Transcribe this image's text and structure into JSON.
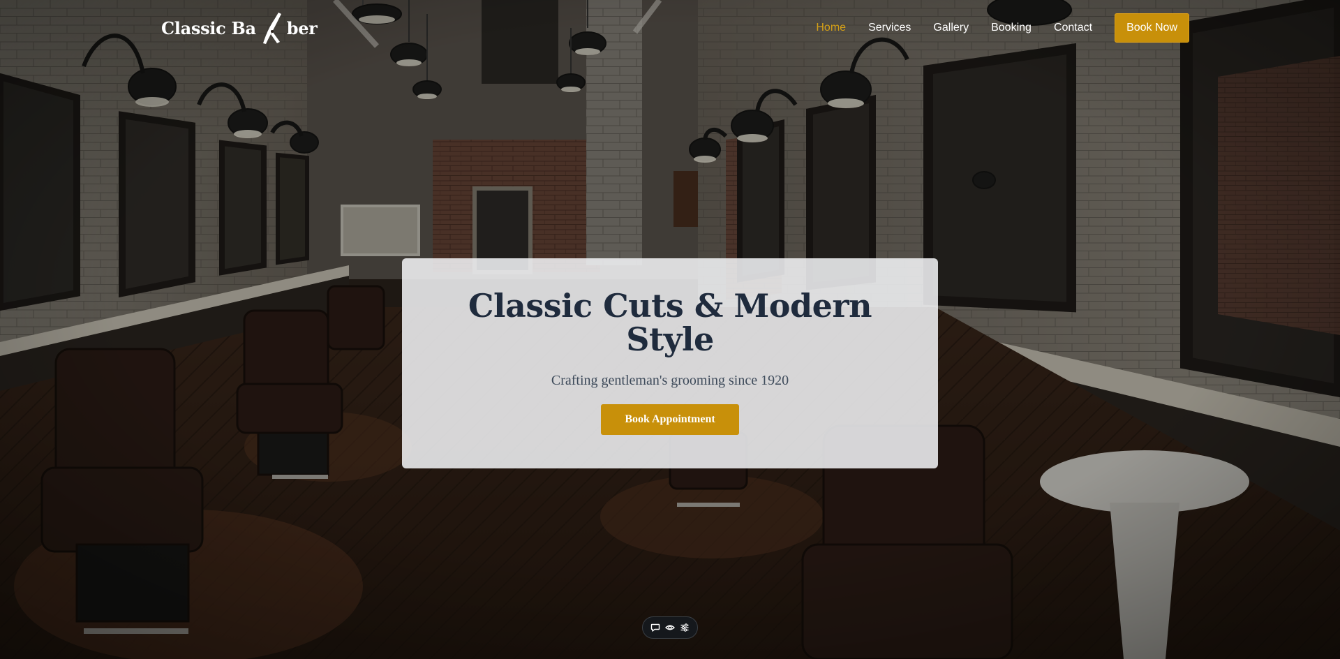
{
  "header": {
    "logo": {
      "part1": "Classic Ba",
      "part2": "ber",
      "icon": "razor-icon"
    },
    "nav": [
      {
        "label": "Home",
        "active": true
      },
      {
        "label": "Services",
        "active": false
      },
      {
        "label": "Gallery",
        "active": false
      },
      {
        "label": "Booking",
        "active": false
      },
      {
        "label": "Contact",
        "active": false
      }
    ],
    "book_now_label": "Book Now"
  },
  "hero": {
    "title": "Classic Cuts & Modern Style",
    "subtitle": "Crafting gentleman's grooming since 1920",
    "cta_label": "Book Appointment",
    "background": "barbershop-interior-photo"
  },
  "toolbar": {
    "items": [
      {
        "icon": "comment-icon"
      },
      {
        "icon": "eye-icon"
      },
      {
        "icon": "sliders-icon"
      }
    ]
  },
  "colors": {
    "accent": "#c8900a",
    "nav_active": "#d4a017",
    "title": "#1f2b3d",
    "card": "#f5f6f8"
  }
}
